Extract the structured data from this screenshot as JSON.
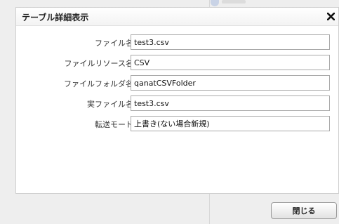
{
  "dialog": {
    "title": "テーブル詳細表示",
    "fields": [
      {
        "label": "ファイル名：",
        "value": "test3.csv"
      },
      {
        "label": "ファイルリソース名：",
        "value": "CSV"
      },
      {
        "label": "ファイルフォルダ名：",
        "value": "qanatCSVFolder"
      },
      {
        "label": "実ファイル名：",
        "value": "test3.csv"
      },
      {
        "label": "転送モード：",
        "value": "上書き(ない場合新規)"
      }
    ],
    "close_label": "閉じる"
  }
}
